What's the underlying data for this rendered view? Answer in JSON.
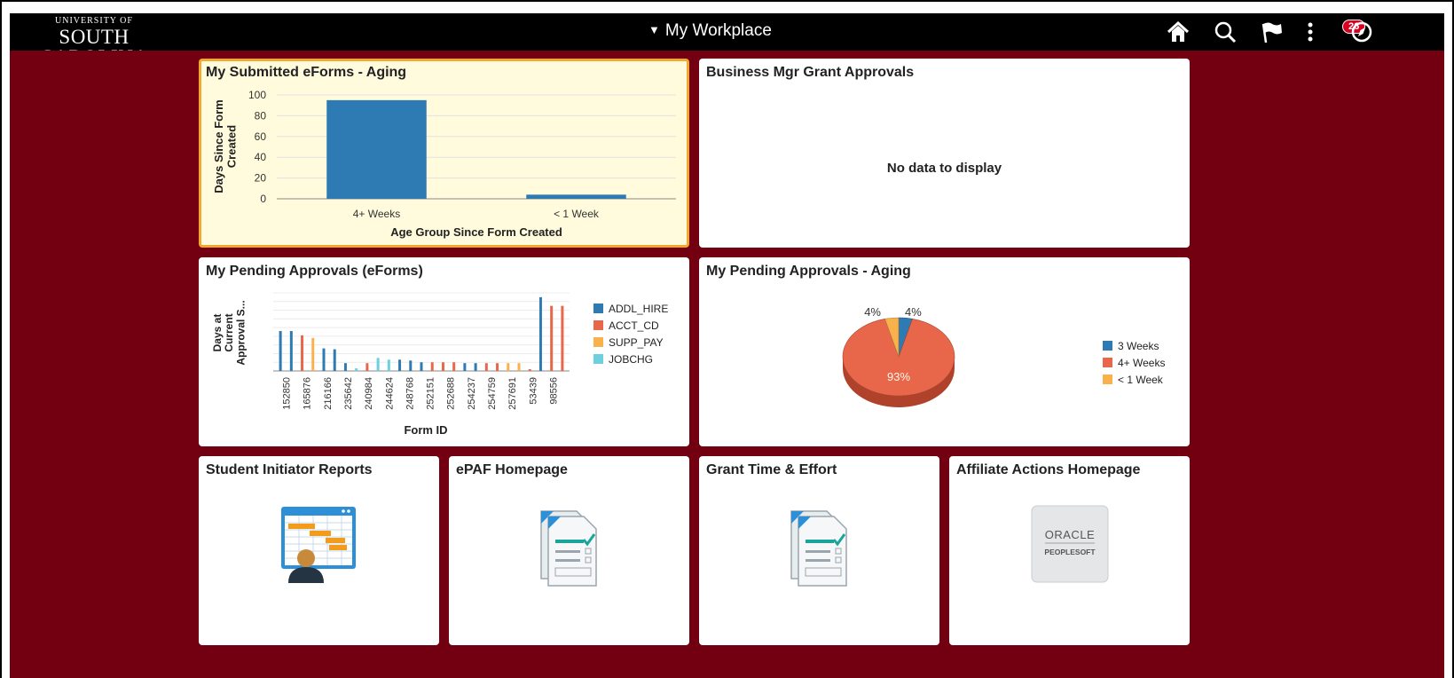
{
  "header": {
    "logo_line1": "UNIVERSITY OF",
    "logo_line2": "SOUTH CAROLINA",
    "title": "My Workplace",
    "notifications_count": "26",
    "icons": [
      "home-icon",
      "search-icon",
      "flag-icon",
      "more-icon",
      "compass-icon"
    ]
  },
  "colors": {
    "topbar": "#000000",
    "background": "#730010",
    "accent": "#f0a830",
    "series_blue": "#2e7bb4",
    "series_red": "#e8674a",
    "series_orange": "#f9b24b",
    "series_cyan": "#6cd1dd"
  },
  "tiles": {
    "submitted": {
      "title": "My Submitted eForms - Aging"
    },
    "grant_approvals": {
      "title": "Business Mgr Grant Approvals",
      "empty_text": "No data to display"
    },
    "pending": {
      "title": "My Pending Approvals (eForms)"
    },
    "pending_aging": {
      "title": "My Pending Approvals - Aging"
    },
    "student_reports": {
      "title": "Student Initiator Reports",
      "icon": "gantt-report-icon"
    },
    "epaf": {
      "title": "ePAF Homepage",
      "icon": "checklist-document-icon"
    },
    "grant_time": {
      "title": "Grant Time & Effort",
      "icon": "checklist-document-icon"
    },
    "affiliate": {
      "title": "Affiliate Actions Homepage",
      "icon": "oracle-peoplesoft-logo",
      "logo_line1": "ORACLE",
      "logo_line2": "PEOPLESOFT"
    }
  },
  "chart_data": [
    {
      "type": "bar",
      "categories": [
        "4+ Weeks",
        "< 1 Week"
      ],
      "values": [
        95,
        4
      ],
      "xlabel": "Age Group Since Form Created",
      "ylabel": "Days Since Form Created",
      "ylim": [
        0,
        100
      ],
      "yticks": [
        0,
        20,
        40,
        60,
        80,
        100
      ],
      "grid": true
    },
    {
      "type": "bar",
      "xlabel": "Form ID",
      "ylabel": "Days at Current Approval S...",
      "x_tick_labels": [
        "152850",
        "165876",
        "216166",
        "235642",
        "240984",
        "244624",
        "248768",
        "252151",
        "252688",
        "254237",
        "254759",
        "257691",
        "53439",
        "98556"
      ],
      "legend_position": "right",
      "series": [
        {
          "name": "ADDL_HIRE",
          "color": "#2e7bb4"
        },
        {
          "name": "ACCT_CD",
          "color": "#e8674a"
        },
        {
          "name": "SUPP_PAY",
          "color": "#f9b24b"
        },
        {
          "name": "JOBCHG",
          "color": "#6cd1dd"
        }
      ],
      "bars": [
        {
          "series": "ADDL_HIRE",
          "value": 46
        },
        {
          "series": "ADDL_HIRE",
          "value": 46
        },
        {
          "series": "ACCT_CD",
          "value": 41
        },
        {
          "series": "SUPP_PAY",
          "value": 38
        },
        {
          "series": "ADDL_HIRE",
          "value": 26
        },
        {
          "series": "ADDL_HIRE",
          "value": 25
        },
        {
          "series": "ADDL_HIRE",
          "value": 9
        },
        {
          "series": "JOBCHG",
          "value": 3
        },
        {
          "series": "ACCT_CD",
          "value": 9
        },
        {
          "series": "JOBCHG",
          "value": 15
        },
        {
          "series": "JOBCHG",
          "value": 13
        },
        {
          "series": "ADDL_HIRE",
          "value": 13
        },
        {
          "series": "ADDL_HIRE",
          "value": 12
        },
        {
          "series": "ADDL_HIRE",
          "value": 10
        },
        {
          "series": "ACCT_CD",
          "value": 10
        },
        {
          "series": "ACCT_CD",
          "value": 10
        },
        {
          "series": "ACCT_CD",
          "value": 10
        },
        {
          "series": "ADDL_HIRE",
          "value": 9
        },
        {
          "series": "ADDL_HIRE",
          "value": 9
        },
        {
          "series": "ACCT_CD",
          "value": 9
        },
        {
          "series": "ACCT_CD",
          "value": 9
        },
        {
          "series": "SUPP_PAY",
          "value": 9
        },
        {
          "series": "SUPP_PAY",
          "value": 9
        },
        {
          "series": "ACCT_CD",
          "value": 2
        },
        {
          "series": "ADDL_HIRE",
          "value": 85
        },
        {
          "series": "ACCT_CD",
          "value": 75
        },
        {
          "series": "ACCT_CD",
          "value": 75
        }
      ],
      "grid": true
    },
    {
      "type": "pie",
      "labels": [
        "3 Weeks",
        "4+ Weeks",
        "< 1 Week"
      ],
      "values": [
        4,
        93,
        4
      ],
      "value_labels": [
        "4%",
        "93%",
        "4%"
      ],
      "colors": [
        "#2e7bb4",
        "#e8674a",
        "#f9b24b"
      ],
      "legend_position": "right",
      "style": "3d"
    }
  ]
}
